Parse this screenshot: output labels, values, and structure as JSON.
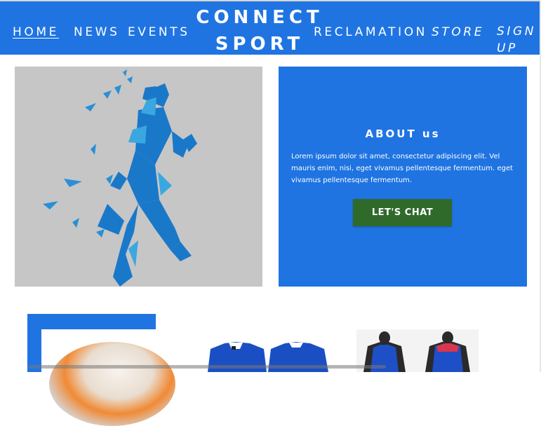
{
  "header": {
    "brand": "CONNECT SPORT",
    "nav": {
      "home": "HOME",
      "news": "NEWS",
      "events": "EVENTS",
      "reclamation": "RECLAMATION",
      "store": "STORE",
      "signup": "SIGN UP"
    }
  },
  "about": {
    "title": "ABOUT us",
    "body": "Lorem ipsum dolor sit amet, consectetur adipiscing elit. Vel mauris enim, nisi, eget vivamus pellentesque fermentum. eget vivamus pellentesque fermentum.",
    "cta_label": "LET'S CHAT"
  },
  "colors": {
    "primary": "#1f74e2",
    "cta": "#2f6a2b",
    "hero_bg": "#c6c6c6"
  },
  "images": {
    "hero": "low-poly-runner-illustration",
    "products": [
      "soccer-ball",
      "blue-jerseys",
      "blue-tank-tops-on-mannequins"
    ]
  }
}
